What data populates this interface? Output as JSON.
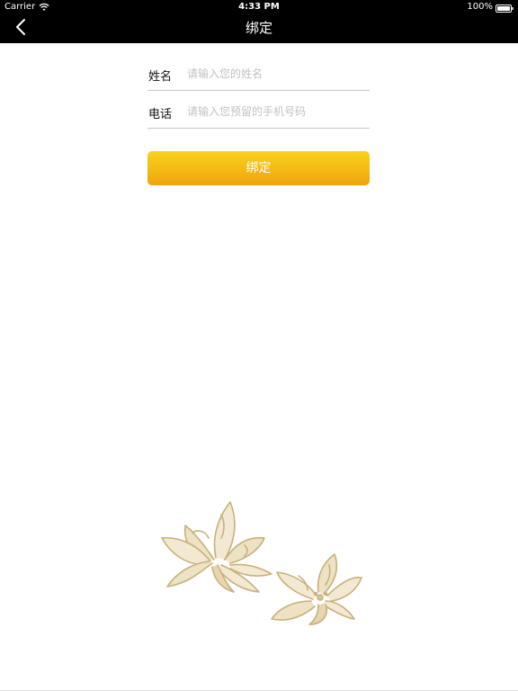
{
  "status_bar": {
    "carrier": "Carrier",
    "time": "4:33 PM",
    "battery": "100%"
  },
  "nav": {
    "title": "绑定",
    "back_icon": "chevron-left-icon"
  },
  "form": {
    "name_label": "姓名",
    "name_value": "",
    "name_placeholder": "请输入您的姓名",
    "phone_label": "电话",
    "phone_value": "",
    "phone_placeholder": "请输入您预留的手机号码"
  },
  "bind_button": {
    "label": "绑定"
  },
  "colors": {
    "nav_background": "#000000",
    "button_gradient_top": "#f7d21c",
    "button_gradient_bottom": "#f0a40e",
    "flower_stroke": "#c8b07a",
    "flower_fill": "#d9c394"
  }
}
